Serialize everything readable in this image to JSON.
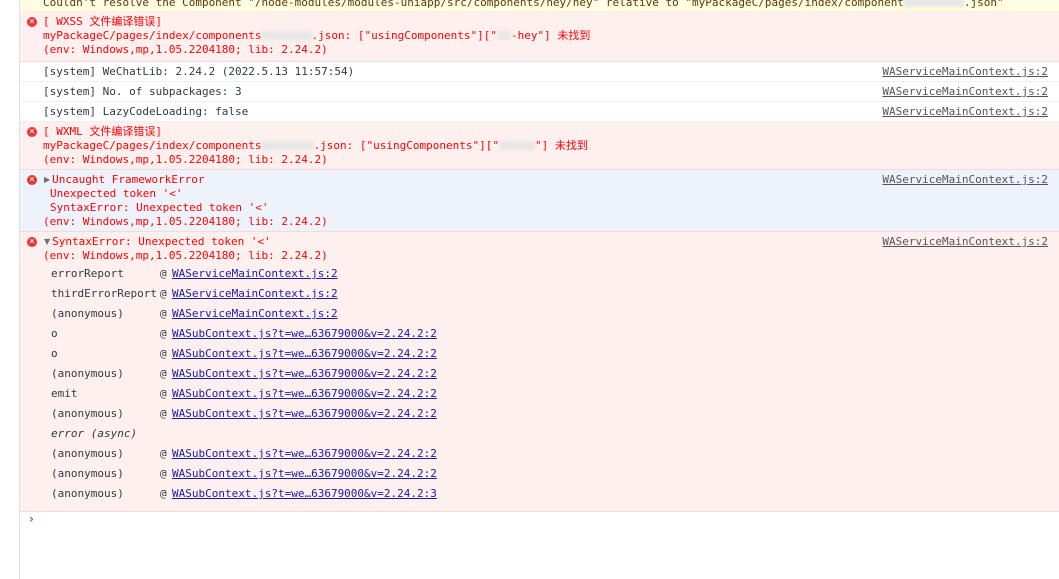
{
  "messages": {
    "warn_top": "Couldn't resolve the Component \"/node-modules/modules-uniapp/src/components/hey/hey\" relative to \"myPackageC/pages/index/component",
    "warn_top_suffix": ".json\"",
    "wxss_err": {
      "title": "[ WXSS 文件编译错误]",
      "line1_a": "myPackageC/pages/index/components",
      "line1_b": ".json: [\"usingComponents\"][\"",
      "line1_c": "-hey\"] 未找到",
      "env": "(env: Windows,mp,1.05.2204180; lib: 2.24.2)"
    },
    "system_lines": [
      {
        "text": "[system] WeChatLib: 2.24.2 (2022.5.13 11:57:54)",
        "source": "WAServiceMainContext.js:2"
      },
      {
        "text": "[system] No. of subpackages: 3",
        "source": "WAServiceMainContext.js:2"
      },
      {
        "text": "[system] LazyCodeLoading: false",
        "source": "WAServiceMainContext.js:2"
      }
    ],
    "wxml_err": {
      "title": "[ WXML 文件编译错误]",
      "line1_a": "myPackageC/pages/index/components",
      "line1_b": ".json: [\"usingComponents\"][\"",
      "line1_c": "\"] 未找到",
      "env": "(env: Windows,mp,1.05.2204180; lib: 2.24.2)"
    },
    "framework_err": {
      "title": "Uncaught FrameworkError",
      "line1": "Unexpected token '<'",
      "line2": "SyntaxError: Unexpected token '<'",
      "env": "(env: Windows,mp,1.05.2204180; lib: 2.24.2)",
      "source": "WAServiceMainContext.js:2"
    },
    "syntax_err": {
      "title": "SyntaxError: Unexpected token '<'",
      "env": "(env: Windows,mp,1.05.2204180; lib: 2.24.2)",
      "source": "WAServiceMainContext.js:2",
      "at": "@",
      "async_label": "error (async)",
      "frames": [
        {
          "fn": "errorReport",
          "link": "WAServiceMainContext.js:2"
        },
        {
          "fn": "thirdErrorReport",
          "link": "WAServiceMainContext.js:2"
        },
        {
          "fn": "(anonymous)",
          "link": "WAServiceMainContext.js:2"
        },
        {
          "fn": "o",
          "link": "WASubContext.js?t=we…63679000&v=2.24.2:2"
        },
        {
          "fn": "o",
          "link": "WASubContext.js?t=we…63679000&v=2.24.2:2"
        },
        {
          "fn": "(anonymous)",
          "link": "WASubContext.js?t=we…63679000&v=2.24.2:2"
        },
        {
          "fn": "emit",
          "link": "WASubContext.js?t=we…63679000&v=2.24.2:2"
        },
        {
          "fn": "(anonymous)",
          "link": "WASubContext.js?t=we…63679000&v=2.24.2:2"
        },
        {
          "fn": "(anonymous)",
          "link": "WASubContext.js?t=we…63679000&v=2.24.2:2"
        },
        {
          "fn": "(anonymous)",
          "link": "WASubContext.js?t=we…63679000&v=2.24.2:2"
        },
        {
          "fn": "(anonymous)",
          "link": "WASubContext.js?t=we…63679000&v=2.24.2:3"
        }
      ]
    }
  },
  "prompt_symbol": "›",
  "icons": {
    "error": "error-circle-x-icon",
    "expand": "triangle-right-icon",
    "collapse": "triangle-down-icon"
  },
  "colors": {
    "error_text": "#ff0000",
    "error_bg": "#fff0f0",
    "link": "#1a1aa6",
    "warn_bg": "#fffbe5"
  }
}
